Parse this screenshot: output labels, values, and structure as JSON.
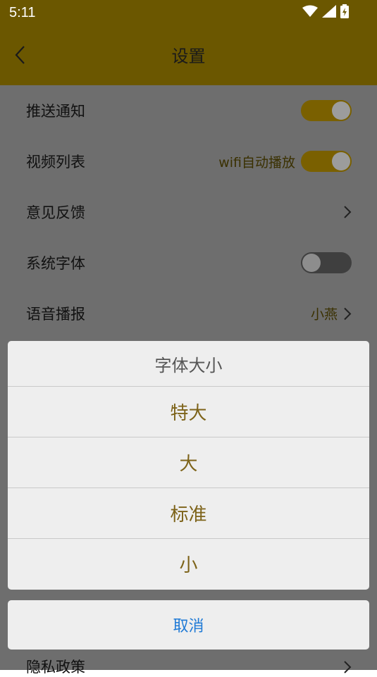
{
  "status_bar": {
    "time": "5:11",
    "icons": [
      "wifi-icon",
      "signal-icon",
      "battery-charging-icon"
    ]
  },
  "app_bar": {
    "title": "设置",
    "back_icon": "chevron-left-icon"
  },
  "settings": {
    "rows": [
      {
        "label": "推送通知",
        "toggle": "on"
      },
      {
        "label": "视频列表",
        "value": "wifi自动播放",
        "toggle": "on"
      },
      {
        "label": "意见反馈",
        "chevron": true
      },
      {
        "label": "系统字体",
        "toggle": "off"
      },
      {
        "label": "语音播报",
        "value": "小燕",
        "chevron": true
      }
    ],
    "partial_row": {
      "label": "隐私政策",
      "chevron": true
    }
  },
  "action_sheet": {
    "title": "字体大小",
    "options": [
      "特大",
      "大",
      "标准",
      "小"
    ],
    "cancel_label": "取消"
  },
  "colors": {
    "header_bg": "#6b5700",
    "overlay_bg": "#6e6e6e",
    "sheet_bg": "#eeeeee",
    "option_text": "#7d6319",
    "cancel_text": "#1f7ad6",
    "toggle_on": "#7a6000",
    "toggle_off": "#3f3f3f"
  }
}
